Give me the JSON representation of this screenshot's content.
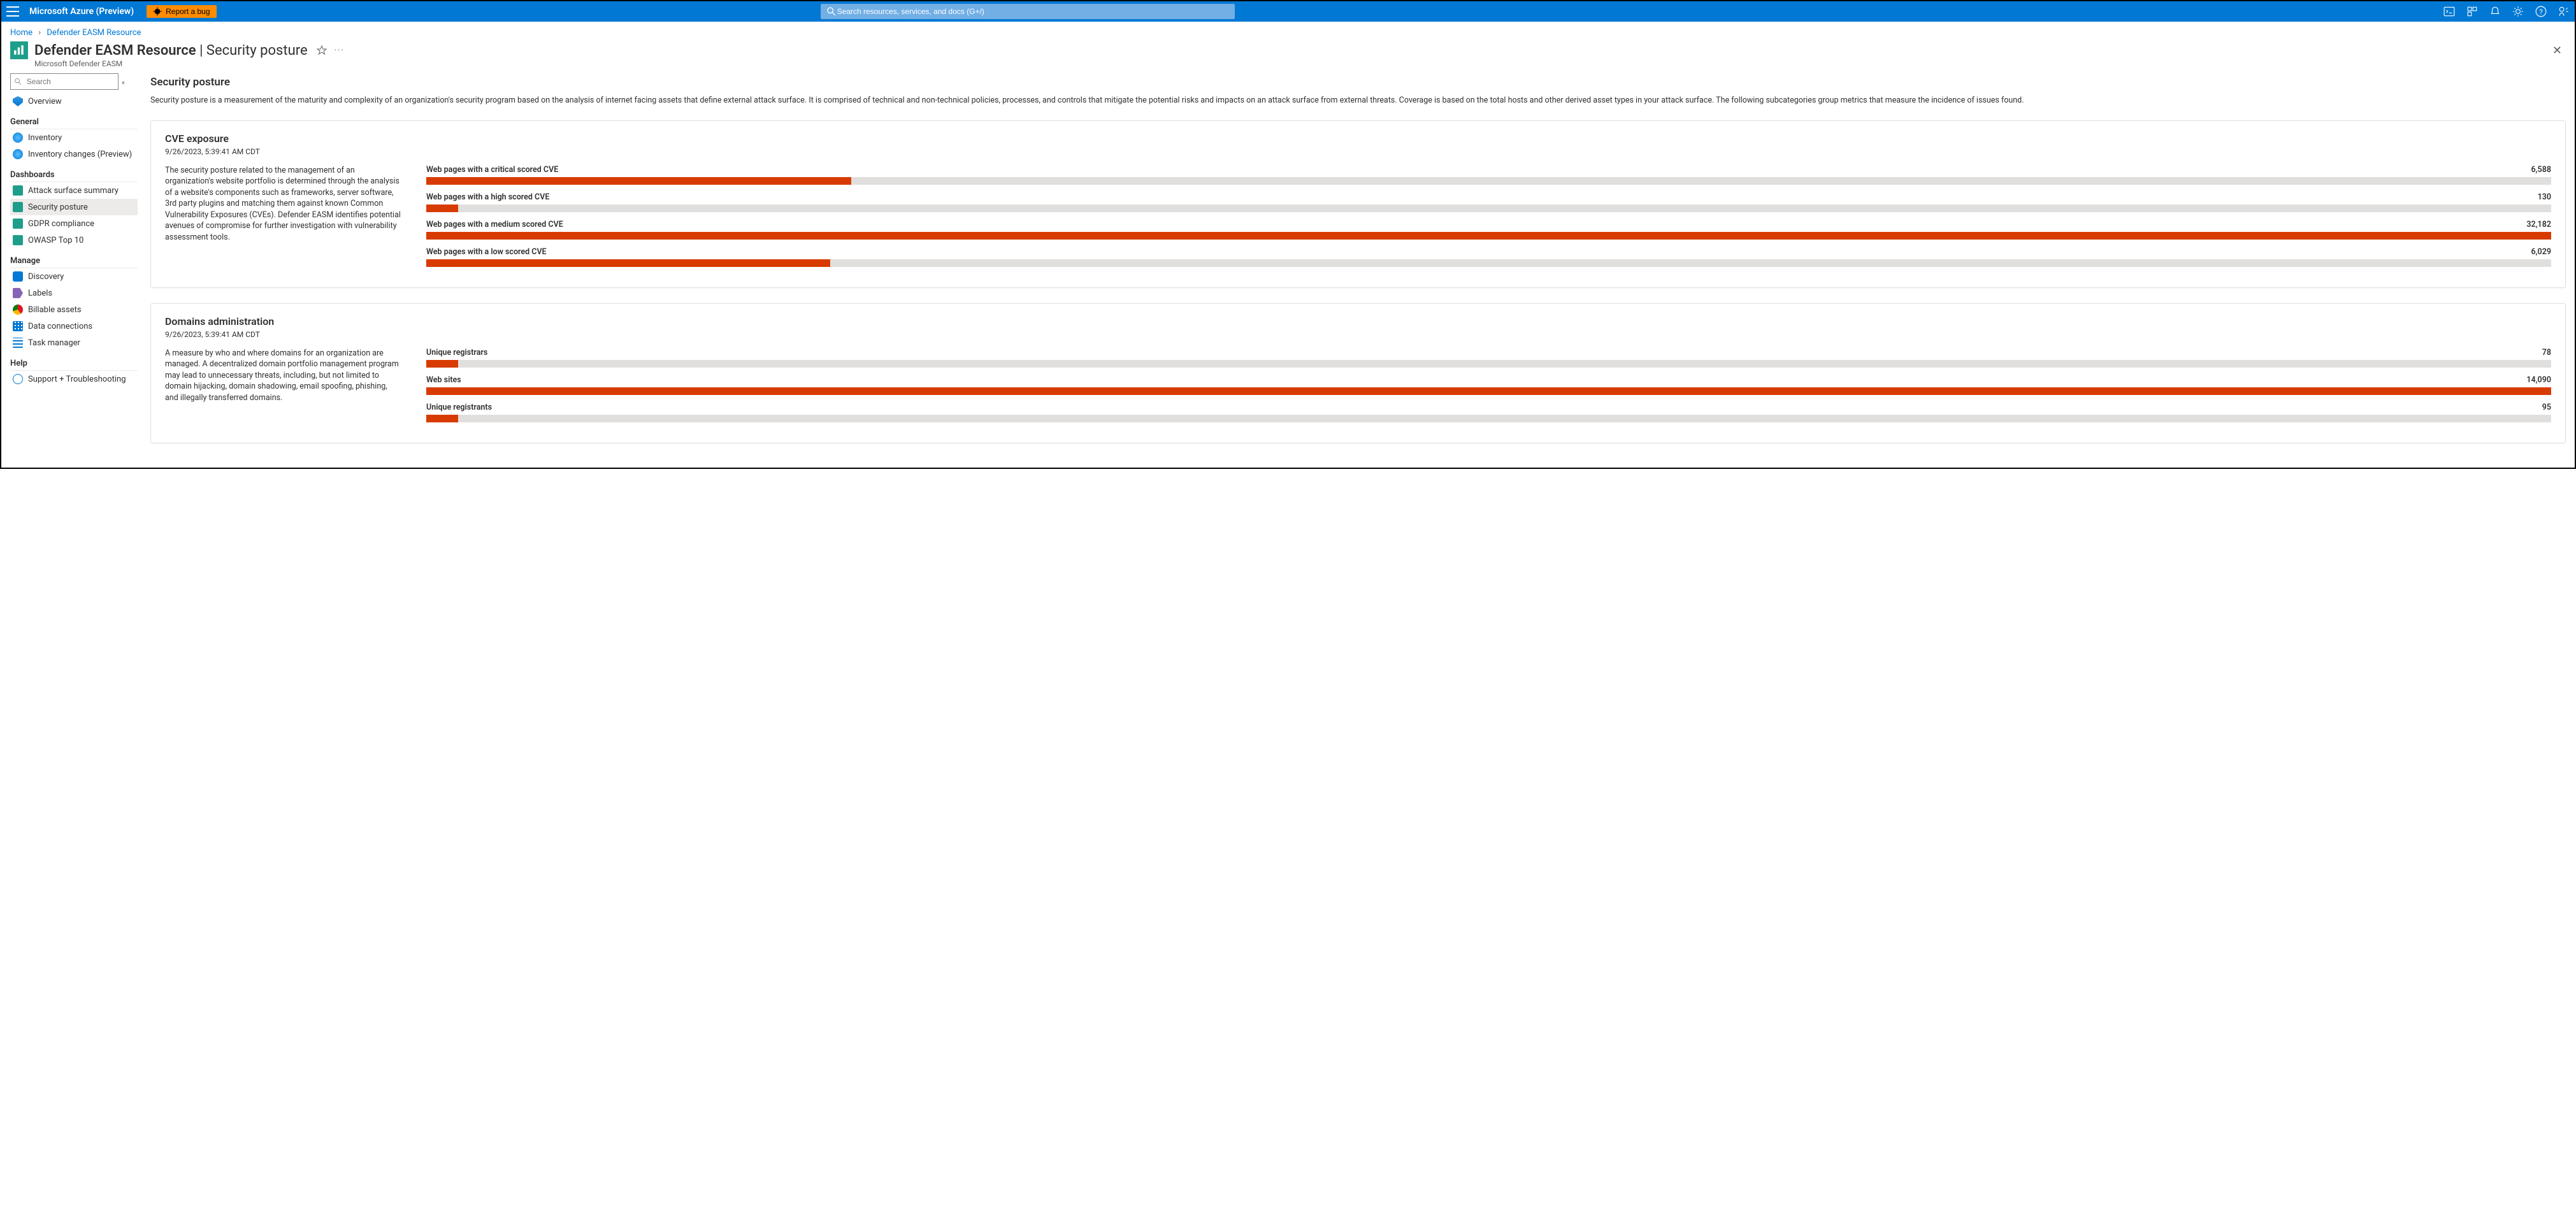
{
  "topbar": {
    "brand": "Microsoft Azure (Preview)",
    "bug_label": "Report a bug",
    "search_placeholder": "Search resources, services, and docs (G+/)"
  },
  "breadcrumb": {
    "home": "Home",
    "current": "Defender EASM Resource"
  },
  "header": {
    "resource_name": "Defender EASM Resource",
    "page_name": "Security posture",
    "product": "Microsoft Defender EASM"
  },
  "sidebar": {
    "search_placeholder": "Search",
    "overview": "Overview",
    "groups": {
      "general": {
        "title": "General",
        "inventory": "Inventory",
        "inventory_changes": "Inventory changes (Preview)"
      },
      "dashboards": {
        "title": "Dashboards",
        "attack_surface": "Attack surface summary",
        "security_posture": "Security posture",
        "gdpr": "GDPR compliance",
        "owasp": "OWASP Top 10"
      },
      "manage": {
        "title": "Manage",
        "discovery": "Discovery",
        "labels": "Labels",
        "billable": "Billable assets",
        "dataconn": "Data connections",
        "taskmgr": "Task manager"
      },
      "help": {
        "title": "Help",
        "support": "Support + Troubleshooting"
      }
    }
  },
  "content": {
    "title": "Security posture",
    "intro": "Security posture is a measurement of the maturity and complexity of an organization's security program based on the analysis of internet facing assets that define external attack surface. It is comprised of technical and non-technical policies, processes, and controls that mitigate the potential risks and impacts on an attack surface from external threats. Coverage is based on the total hosts and other derived asset types in your attack surface. The following subcategories group metrics that measure the incidence of issues found.",
    "cards": [
      {
        "id": "cve",
        "title": "CVE exposure",
        "timestamp": "9/26/2023, 5:39:41 AM CDT",
        "desc": "The security posture related to the management of an organization's website portfolio is determined through the analysis of a website's components such as frameworks, server software, 3rd party plugins and matching them against known Common Vulnerability Exposures (CVEs). Defender EASM identifies potential avenues of compromise for further investigation with vulnerability assessment tools.",
        "metrics": [
          {
            "label": "Web pages with a critical scored CVE",
            "value": "6,588",
            "pct": 20
          },
          {
            "label": "Web pages with a high scored CVE",
            "value": "130",
            "pct": 1.5
          },
          {
            "label": "Web pages with a medium scored CVE",
            "value": "32,182",
            "pct": 100
          },
          {
            "label": "Web pages with a low scored CVE",
            "value": "6,029",
            "pct": 19
          }
        ]
      },
      {
        "id": "domains",
        "title": "Domains administration",
        "timestamp": "9/26/2023, 5:39:41 AM CDT",
        "desc": "A measure by who and where domains for an organization are managed. A decentralized domain portfolio management program may lead to unnecessary threats, including, but not limited to domain hijacking, domain shadowing, email spoofing, phishing, and illegally transferred domains.",
        "metrics": [
          {
            "label": "Unique registrars",
            "value": "78",
            "pct": 1.5
          },
          {
            "label": "Web sites",
            "value": "14,090",
            "pct": 100
          },
          {
            "label": "Unique registrants",
            "value": "95",
            "pct": 1.5
          }
        ]
      }
    ]
  },
  "chart_data": [
    {
      "type": "bar",
      "title": "CVE exposure",
      "categories": [
        "critical",
        "high",
        "medium",
        "low"
      ],
      "values": [
        6588,
        130,
        32182,
        6029
      ],
      "ylim": [
        0,
        32182
      ]
    },
    {
      "type": "bar",
      "title": "Domains administration",
      "categories": [
        "Unique registrars",
        "Web sites",
        "Unique registrants"
      ],
      "values": [
        78,
        14090,
        95
      ],
      "ylim": [
        0,
        14090
      ]
    }
  ]
}
